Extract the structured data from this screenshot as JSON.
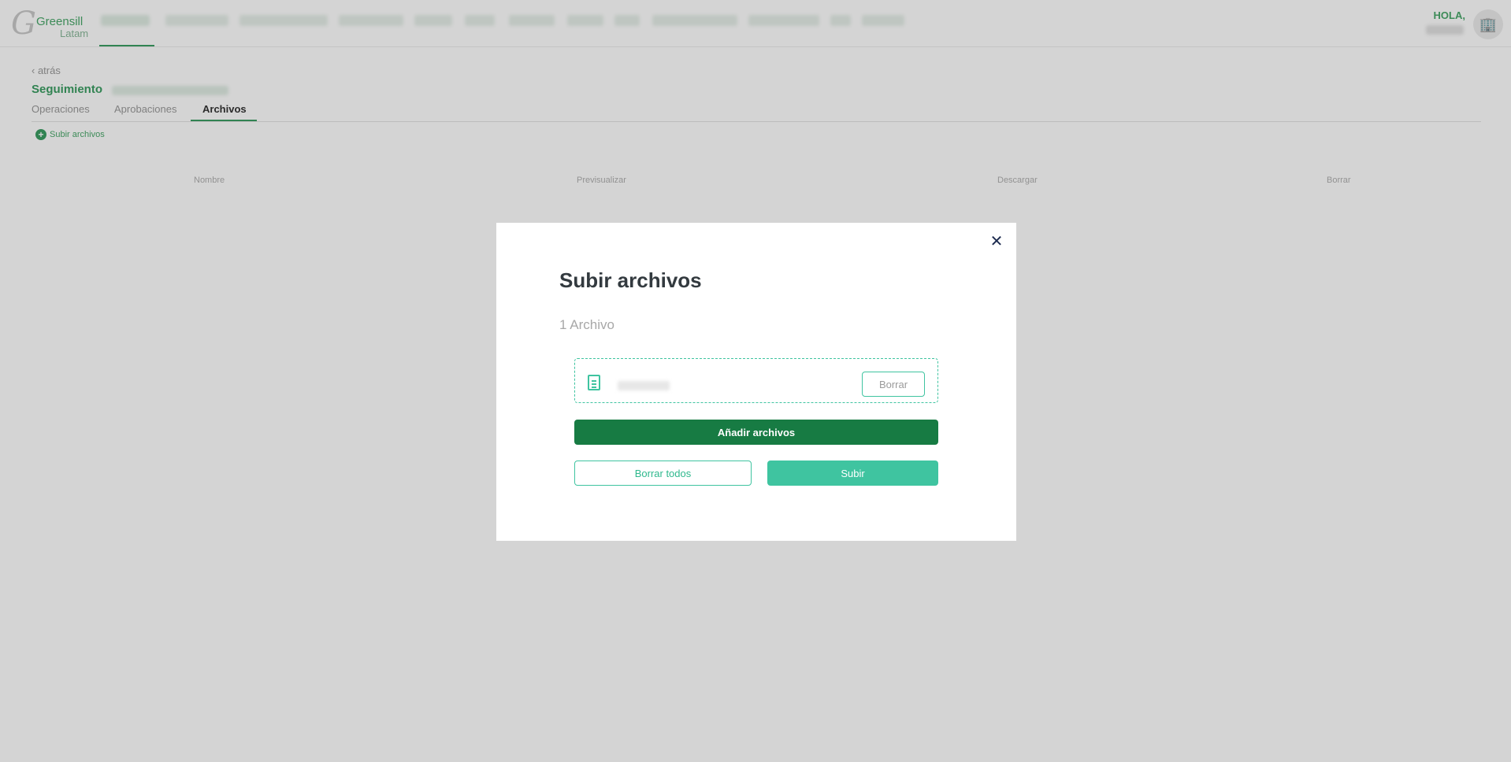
{
  "app": {
    "logo_name": "Greensill",
    "logo_sub": "Latam",
    "greeting": "HOLA,"
  },
  "page": {
    "back_label": "atrás",
    "title": "Seguimiento",
    "tabs": [
      "Operaciones",
      "Aprobaciones",
      "Archivos"
    ],
    "active_tab": "Archivos",
    "add_files_label": "Subir archivos",
    "table_headers": [
      "Nombre",
      "Previsualizar",
      "Descargar",
      "Borrar"
    ]
  },
  "modal": {
    "title": "Subir archivos",
    "file_count": "1 Archivo",
    "remove_label": "Borrar",
    "add_label": "Añadir archivos",
    "clear_all_label": "Borrar todos",
    "upload_label": "Subir",
    "close_icon": "close-icon"
  },
  "colors": {
    "primary_dark": "#177b43",
    "primary_light": "#3fc4a0",
    "brand_green": "#3c9e63"
  }
}
